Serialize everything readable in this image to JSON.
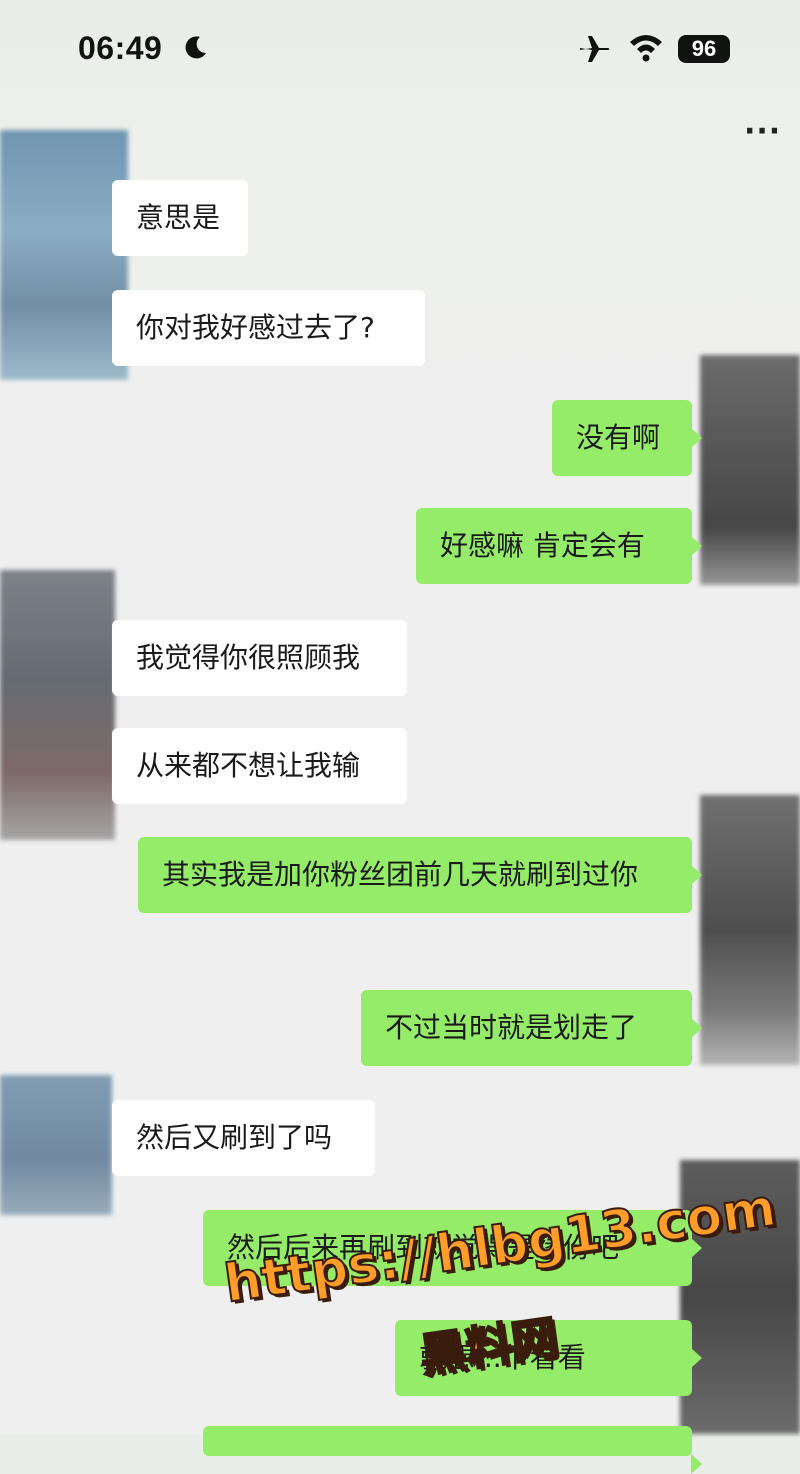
{
  "status_bar": {
    "time": "06:49",
    "battery": "96"
  },
  "header": {
    "more_label": "···"
  },
  "messages": [
    {
      "side": "in",
      "text": "意思是"
    },
    {
      "side": "in",
      "text": "你对我好感过去了?"
    },
    {
      "side": "out",
      "text": "没有啊"
    },
    {
      "side": "out",
      "text": "好感嘛 肯定会有"
    },
    {
      "side": "in",
      "text": "我觉得你很照顾我"
    },
    {
      "side": "in",
      "text": "从来都不想让我输"
    },
    {
      "side": "out",
      "text": "其实我是加你粉丝团前几天就刷到过你"
    },
    {
      "side": "out",
      "text": "不过当时就是划走了"
    },
    {
      "side": "in",
      "text": "然后又刷到了吗"
    },
    {
      "side": "out",
      "text": "然后后来再刷到就觉得是缘份吧"
    },
    {
      "side": "out",
      "text": "就想...下看看"
    }
  ],
  "watermark": {
    "url": "https://hlbg13.com",
    "name": "黑料网"
  },
  "colors": {
    "outgoing_bubble": "#95ec69",
    "incoming_bubble": "#ffffff",
    "watermark": "#ff9d2a"
  }
}
